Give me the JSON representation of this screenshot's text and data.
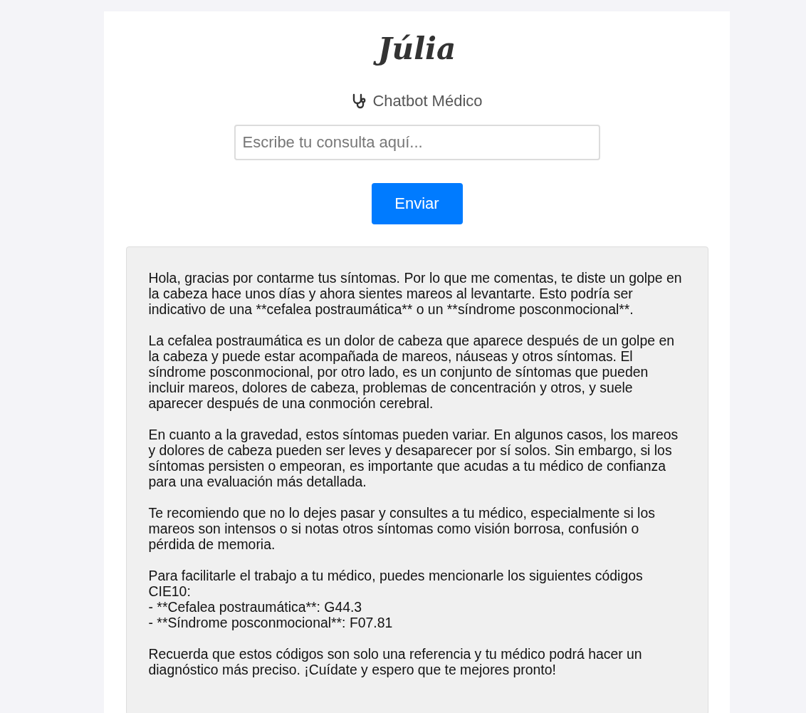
{
  "title": "Júlia",
  "subtitle": "Chatbot Médico",
  "search": {
    "placeholder": "Escribe tu consulta aquí..."
  },
  "send_button": "Enviar",
  "response": {
    "paragraphs": [
      "Hola, gracias por contarme tus síntomas. Por lo que me comentas, te diste un golpe en la cabeza hace unos días y ahora sientes mareos al levantarte. Esto podría ser indicativo de una **cefalea postraumática** o un **síndrome posconmocional**.",
      "La cefalea postraumática es un dolor de cabeza que aparece después de un golpe en la cabeza y puede estar acompañada de mareos, náuseas y otros síntomas. El síndrome posconmocional, por otro lado, es un conjunto de síntomas que pueden incluir mareos, dolores de cabeza, problemas de concentración y otros, y suele aparecer después de una conmoción cerebral.",
      "En cuanto a la gravedad, estos síntomas pueden variar. En algunos casos, los mareos y dolores de cabeza pueden ser leves y desaparecer por sí solos. Sin embargo, si los síntomas persisten o empeoran, es importante que acudas a tu médico de confianza para una evaluación más detallada.",
      "Te recomiendo que no lo dejes pasar y consultes a tu médico, especialmente si los mareos son intensos o si notas otros síntomas como visión borrosa, confusión o pérdida de memoria.",
      "Para facilitarle el trabajo a tu médico, puedes mencionarle los siguientes códigos CIE10:\n- **Cefalea postraumática**: G44.3\n- **Síndrome posconmocional**: F07.81",
      "Recuerda que estos códigos son solo una referencia y tu médico podrá hacer un diagnóstico más preciso. ¡Cuídate y espero que te mejores pronto!"
    ]
  }
}
